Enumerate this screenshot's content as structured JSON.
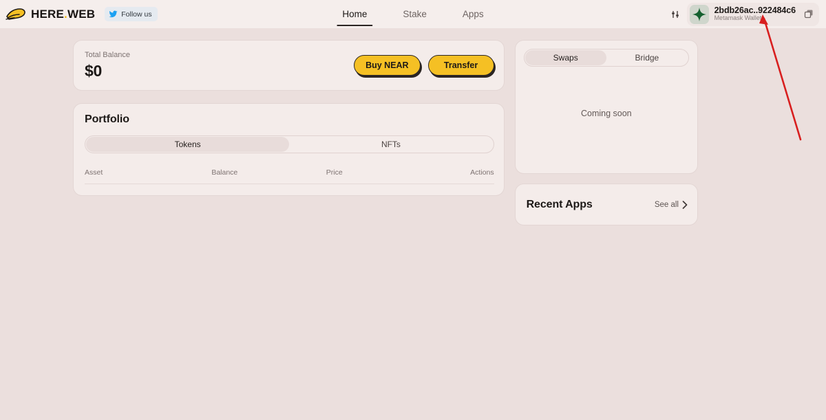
{
  "header": {
    "logo_icon": "here-hat-icon",
    "logo_text": "HERE",
    "logo_dot": ".",
    "logo_text2": "WEB",
    "follow": {
      "icon": "twitter-icon",
      "label": "Follow us"
    },
    "nav": [
      {
        "label": "Home",
        "active": true
      },
      {
        "label": "Stake",
        "active": false
      },
      {
        "label": "Apps",
        "active": false
      }
    ],
    "sliders_icon": "sliders-icon",
    "wallet": {
      "avatar_icon": "wallet-avatar-star-icon",
      "address": "2bdb26ac..922484c6",
      "type": "Metamask Wallet",
      "copy_icon": "copy-icon"
    }
  },
  "balance": {
    "label": "Total Balance",
    "value": "$0",
    "buy_label": "Buy NEAR",
    "transfer_label": "Transfer"
  },
  "portfolio": {
    "title": "Portfolio",
    "tabs": [
      {
        "label": "Tokens",
        "active": true
      },
      {
        "label": "NFTs",
        "active": false
      }
    ],
    "columns": {
      "asset": "Asset",
      "balance": "Balance",
      "price": "Price",
      "actions": "Actions"
    },
    "rows": []
  },
  "swaps": {
    "tabs": [
      {
        "label": "Swaps",
        "active": true
      },
      {
        "label": "Bridge",
        "active": false
      }
    ],
    "empty_text": "Coming soon"
  },
  "recent_apps": {
    "title": "Recent Apps",
    "see_all": "See all",
    "chevron_icon": "chevron-right-icon"
  },
  "annotation": {
    "arrow_icon": "red-arrow-icon",
    "color": "#d81f1f"
  },
  "colors": {
    "page_bg": "#ebdfdd",
    "card_bg": "#f4ecea",
    "header_bg": "#f5eeec",
    "accent_yellow": "#f5c024",
    "twitter_blue": "#1da1f2",
    "ink": "#2b2523",
    "muted": "#7d7271"
  }
}
